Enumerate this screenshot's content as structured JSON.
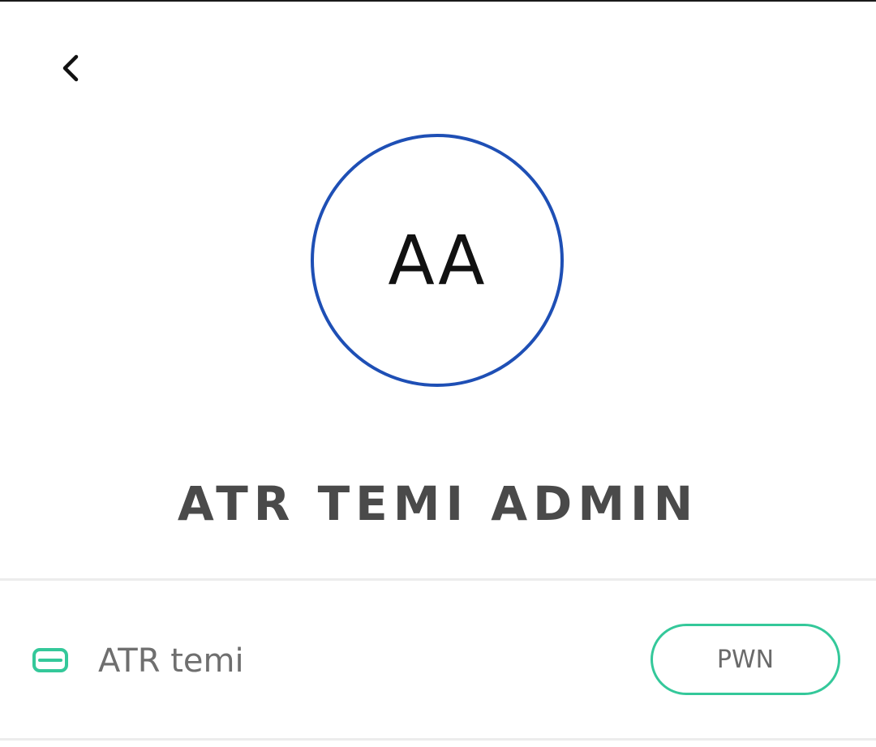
{
  "header": {
    "back_icon": "chevron-left-icon"
  },
  "profile": {
    "initials": "AA",
    "name": "ATR TEMI ADMIN",
    "avatar_border_color": "#1e4fb5"
  },
  "robot": {
    "icon": "robot-device-icon",
    "name": "ATR temi",
    "action_label": "PWN",
    "accent_color": "#34c89a"
  }
}
